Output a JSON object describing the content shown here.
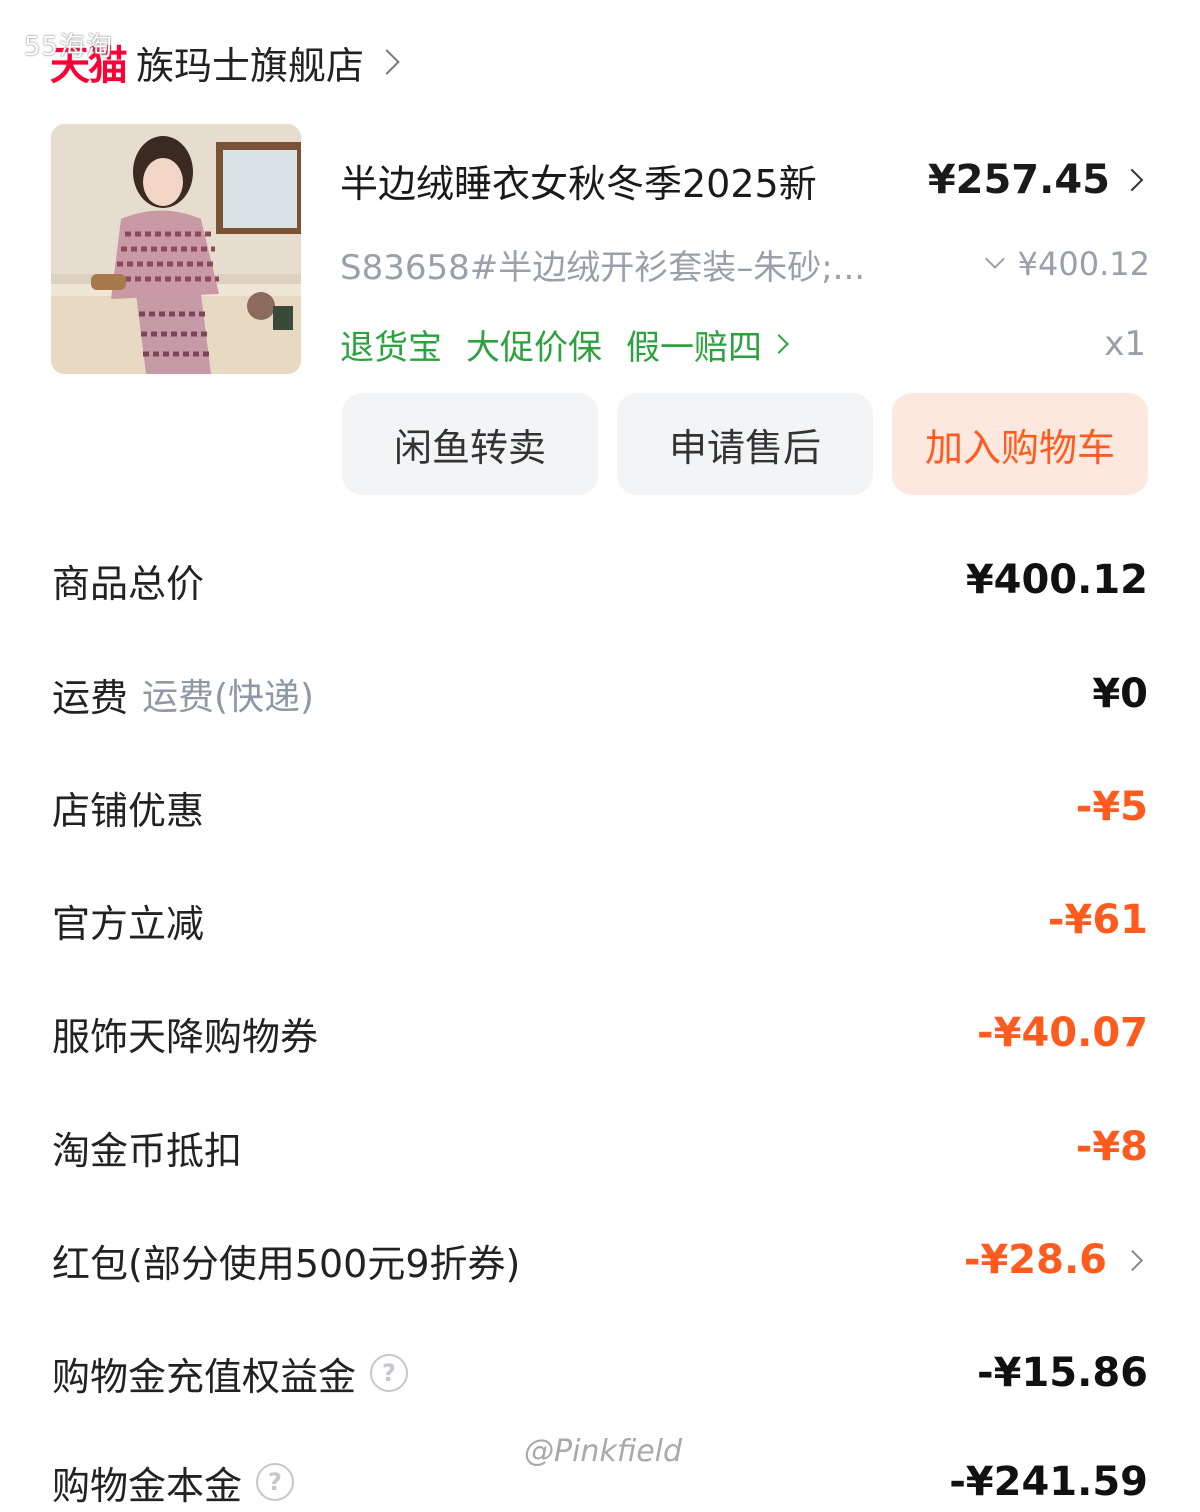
{
  "watermark_top": "55海淘",
  "watermark_bottom": "@Pinkfield",
  "shop": {
    "logo_text": "天猫",
    "name": "族玛士旗舰店"
  },
  "item": {
    "title": "半边绒睡衣女秋冬季2025新",
    "price": "¥257.45",
    "sku": "S83658#半边绒开衫套装–朱砂;...",
    "original_price": "¥400.12",
    "tags": [
      "退货宝",
      "大促价保",
      "假一赔四"
    ],
    "quantity": "x1"
  },
  "actions": {
    "resell": "闲鱼转卖",
    "after_sales": "申请售后",
    "add_to_cart": "加入购物车"
  },
  "summary": [
    {
      "label": "商品总价",
      "value": "¥400.12"
    },
    {
      "label": "运费",
      "sub": "运费(快递)",
      "value": "¥0"
    },
    {
      "label": "店铺优惠",
      "value": "-¥5"
    },
    {
      "label": "官方立减",
      "value": "-¥61"
    },
    {
      "label": "服饰天降购物券",
      "value": "-¥40.07"
    },
    {
      "label": "淘金币抵扣",
      "value": "-¥8"
    },
    {
      "label": "红包(部分使用500元9折券)",
      "value": "-¥28.6"
    },
    {
      "label": "购物金充值权益金",
      "value": "-¥15.86"
    },
    {
      "label": "购物金本金",
      "value": "-¥241.59"
    }
  ],
  "colors": {
    "tmall_red": "#ff0036",
    "accent_orange": "#ff5b1e",
    "service_green": "#2ba23e",
    "muted_gray": "#9aa0aa"
  }
}
